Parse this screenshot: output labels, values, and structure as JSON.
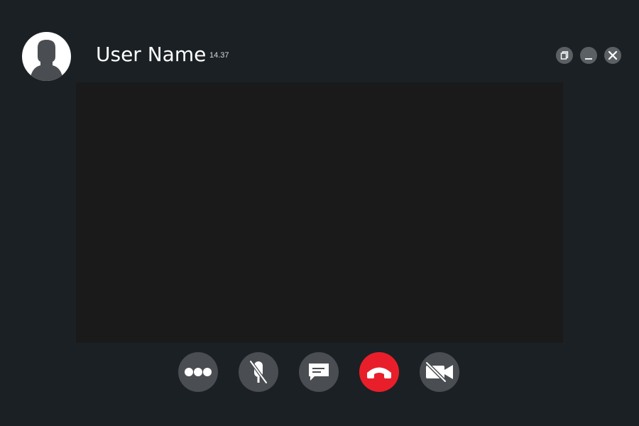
{
  "header": {
    "user_name": "User Name",
    "call_time": "14.37"
  },
  "window_controls": [
    {
      "icon": "restore-icon"
    },
    {
      "icon": "minimize-icon"
    },
    {
      "icon": "close-icon"
    }
  ],
  "call_controls": [
    {
      "icon": "more-options-icon"
    },
    {
      "icon": "microphone-muted-icon"
    },
    {
      "icon": "chat-icon"
    },
    {
      "icon": "end-call-icon"
    },
    {
      "icon": "video-off-icon"
    }
  ],
  "colors": {
    "background": "#1b2024",
    "video_area": "#1a1a1a",
    "control_button": "#4a4e52",
    "end_call": "#e81f2a",
    "window_button": "#5b6064",
    "text": "#ffffff"
  }
}
